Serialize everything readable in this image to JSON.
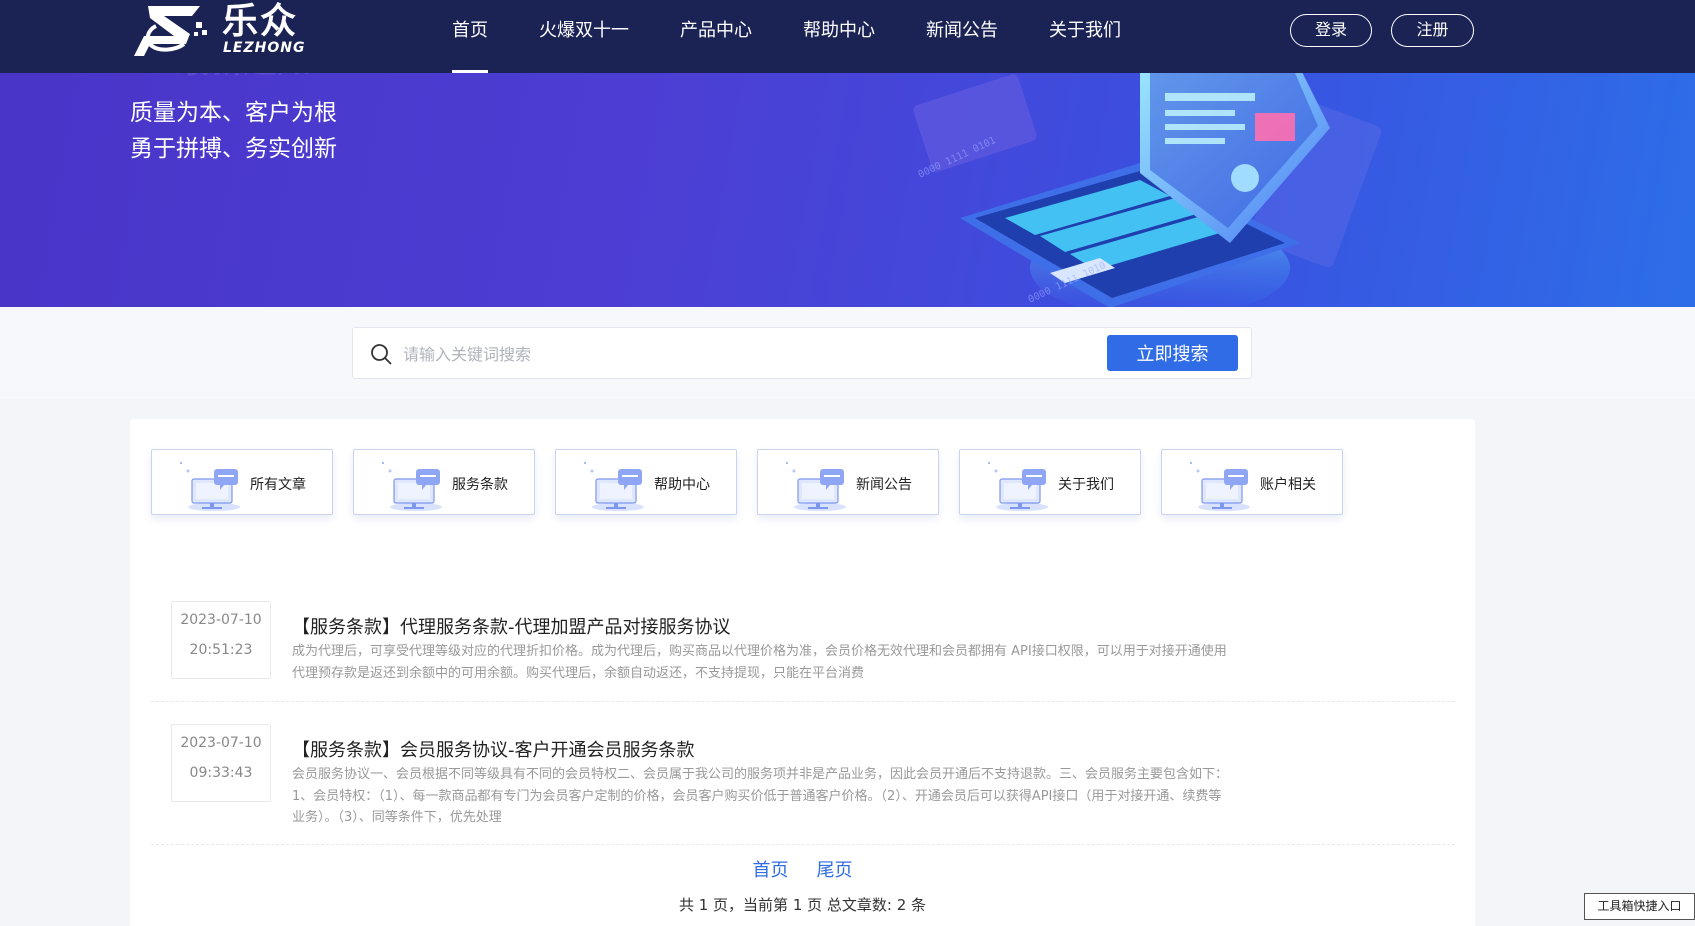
{
  "header": {
    "logo_text": "乐众",
    "logo_sub": "LEZHONG",
    "nav": [
      {
        "label": "首页",
        "active": true
      },
      {
        "label": "火爆双十一"
      },
      {
        "label": "产品中心"
      },
      {
        "label": "帮助中心"
      },
      {
        "label": "新闻公告"
      },
      {
        "label": "关于我们"
      }
    ],
    "login_label": "登录",
    "register_label": "注册"
  },
  "banner": {
    "faint_text": "最新通知",
    "slogan_line1": "质量为本、客户为根",
    "slogan_line2": "勇于拼搏、务实创新"
  },
  "search": {
    "placeholder": "请输入关键词搜索",
    "button_label": "立即搜索"
  },
  "categories": [
    {
      "label": "所有文章"
    },
    {
      "label": "服务条款"
    },
    {
      "label": "帮助中心"
    },
    {
      "label": "新闻公告"
    },
    {
      "label": "关于我们"
    },
    {
      "label": "账户相关"
    }
  ],
  "articles": [
    {
      "date": "2023-07-10",
      "time": "20:51:23",
      "title": "【服务条款】代理服务条款-代理加盟产品对接服务协议",
      "summary": "成为代理后，可享受代理等级对应的代理折扣价格。成为代理后，购买商品以代理价格为准，会员价格无效代理和会员都拥有 API接口权限，可以用于对接开通使用代理预存款是返还到余额中的可用余额。购买代理后，余额自动返还，不支持提现，只能在平台消费"
    },
    {
      "date": "2023-07-10",
      "time": "09:33:43",
      "title": "【服务条款】会员服务协议-客户开通会员服务条款",
      "summary": "会员服务协议一、会员根据不同等级具有不同的会员特权二、会员属于我公司的服务项并非是产品业务，因此会员开通后不支持退款。三、会员服务主要包含如下：1、会员特权：（1）、每一款商品都有专门为会员客户定制的价格，会员客户购买价低于普通客户价格。（2）、开通会员后可以获得API接口（用于对接开通、续费等业务）。（3）、同等条件下，优先处理"
    }
  ],
  "pagination": {
    "first_label": "首页",
    "last_label": "尾页",
    "info": "共 1 页，当前第 1 页   总文章数: 2 条"
  },
  "toolbox_label": "工具箱快捷入口",
  "colors": {
    "header_bg": "#1b2355",
    "banner_start": "#4935c8",
    "banner_end": "#2d6ee8",
    "accent": "#2f6ce5"
  }
}
